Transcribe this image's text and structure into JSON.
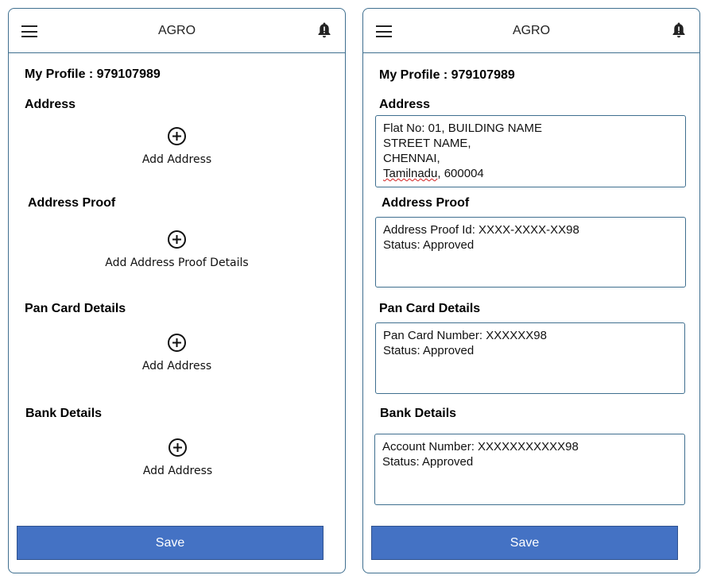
{
  "app": {
    "title": "AGRO"
  },
  "icons": {
    "menu": "hamburger-menu-icon",
    "bell": "bell-alert-icon",
    "add": "plus-circle-icon"
  },
  "colors": {
    "primary_button": "#4472c4",
    "border": "#3f6f8f"
  },
  "empty_profile": {
    "profile_title": "My Profile : 979107989",
    "sections": {
      "address": {
        "heading": "Address",
        "action": "Add Address"
      },
      "address_proof": {
        "heading": "Address Proof",
        "action": "Add Address Proof Details"
      },
      "pan": {
        "heading": "Pan Card Details",
        "action": "Add Address"
      },
      "bank": {
        "heading": "Bank Details",
        "action": "Add Address"
      }
    },
    "save_label": "Save"
  },
  "filled_profile": {
    "profile_title": "My Profile : 979107989",
    "address": {
      "heading": "Address",
      "line1": "Flat No: 01, BUILDING NAME",
      "line2": "STREET NAME,",
      "line3": "CHENNAI,",
      "line4_state": "Tamilnadu",
      "line4_rest": ", 600004"
    },
    "address_proof": {
      "heading": "Address Proof",
      "id": "Address Proof Id: XXXX-XXXX-XX98",
      "status": "Status: Approved"
    },
    "pan": {
      "heading": "Pan Card Details",
      "number": "Pan Card Number: XXXXXX98",
      "status": "Status: Approved"
    },
    "bank": {
      "heading": "Bank Details",
      "account": "Account Number: XXXXXXXXXXX98",
      "status": "Status: Approved"
    },
    "save_label": "Save"
  }
}
